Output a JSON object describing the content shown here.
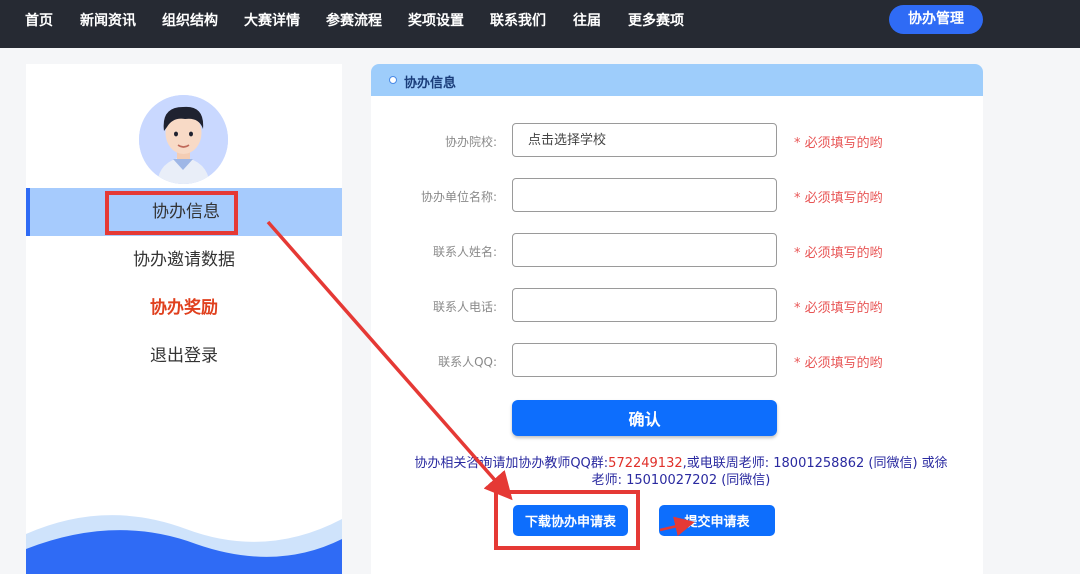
{
  "nav": {
    "items": [
      "首页",
      "新闻资讯",
      "组织结构",
      "大赛详情",
      "参赛流程",
      "奖项设置",
      "联系我们",
      "往届",
      "更多赛项"
    ],
    "manage_button": "协办管理"
  },
  "sidebar": {
    "items": [
      {
        "label": "协办信息"
      },
      {
        "label": "协办邀请数据"
      },
      {
        "label": "协办奖励"
      },
      {
        "label": "退出登录"
      }
    ]
  },
  "panel": {
    "title": "协办信息",
    "fields": [
      {
        "label": "协办院校:",
        "placeholder": "点击选择学校",
        "note": "* 必须填写的哟"
      },
      {
        "label": "协办单位名称:",
        "placeholder": "",
        "note": "* 必须填写的哟"
      },
      {
        "label": "联系人姓名:",
        "placeholder": "",
        "note": "* 必须填写的哟"
      },
      {
        "label": "联系人电话:",
        "placeholder": "",
        "note": "* 必须填写的哟"
      },
      {
        "label": "联系人QQ:",
        "placeholder": "",
        "note": "* 必须填写的哟"
      }
    ],
    "confirm": "确认",
    "contact": {
      "prefix": "协办相关咨询请加协办教师QQ群:",
      "qq": "572249132",
      "middle": ",或电联周老师: 18001258862 (同微信) 或徐老师: 15010027202 (同微信)"
    },
    "download": "下载协办申请表",
    "submit": "提交申请表"
  },
  "colors": {
    "nav_bg": "#262a33",
    "accent": "#0d6efd",
    "annotation": "#e53935",
    "required": "#e85555"
  }
}
